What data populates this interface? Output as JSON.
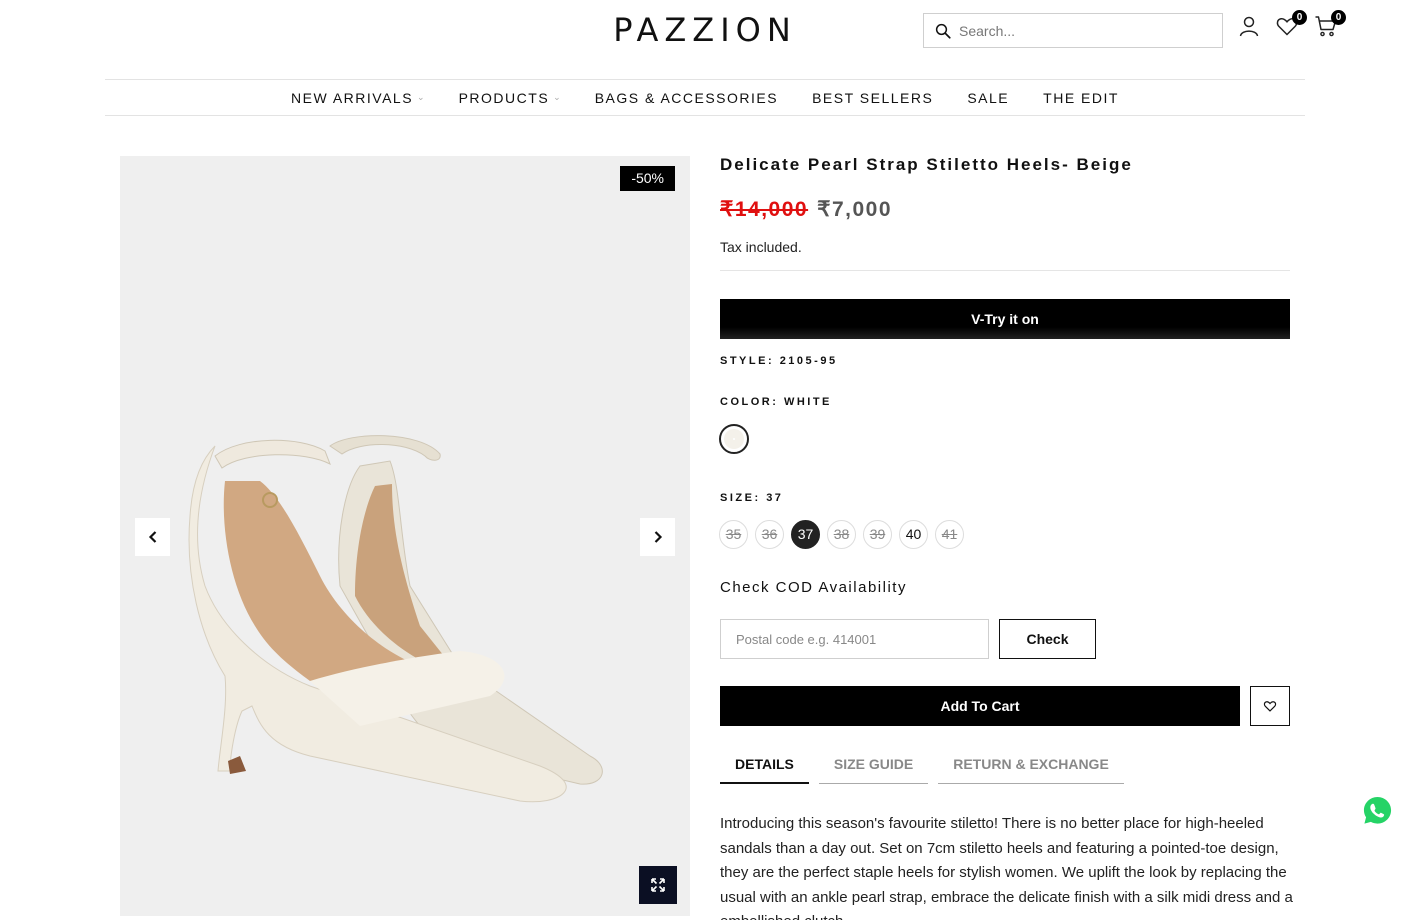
{
  "header": {
    "logo": "PAZZION",
    "search_placeholder": "Search...",
    "wishlist_count": "0",
    "cart_count": "0"
  },
  "nav": {
    "items": [
      {
        "label": "NEW ARRIVALS",
        "dropdown": true
      },
      {
        "label": "PRODUCTS",
        "dropdown": true
      },
      {
        "label": "BAGS & ACCESSORIES",
        "dropdown": false
      },
      {
        "label": "BEST SELLERS",
        "dropdown": false
      },
      {
        "label": "SALE",
        "dropdown": false
      },
      {
        "label": "THE EDIT",
        "dropdown": false
      }
    ]
  },
  "gallery": {
    "discount_badge": "-50%"
  },
  "product": {
    "title": "Delicate Pearl Strap Stiletto Heels- Beige",
    "old_price": "₹14,000",
    "new_price": "₹7,000",
    "tax_note": "Tax included.",
    "vtry_label": "V-Try it on",
    "style_label": "STYLE:",
    "style_value": "2105-95",
    "color_label": "COLOR:",
    "color_value": "WHITE",
    "size_label": "SIZE:",
    "size_value": "37",
    "sizes": [
      "35",
      "36",
      "37",
      "38",
      "39",
      "40",
      "41"
    ],
    "cod_title": "Check COD Availability",
    "postal_placeholder": "Postal code e.g. 414001",
    "check_label": "Check",
    "add_to_cart_label": "Add To Cart"
  },
  "tabs": [
    "DETAILS",
    "SIZE GUIDE",
    "RETURN & EXCHANGE"
  ],
  "description": "Introducing this season's favourite stiletto! There is no better place for high-heeled sandals than a day out. Set on 7cm stiletto heels and featuring a pointed-toe design, they are the perfect staple heels for stylish women. We uplift the look by replacing the usual with an ankle pearl strap, embrace the delicate finish with a silk midi dress and a embellished clutch.",
  "colors": {
    "accent": "#000000",
    "sale_red": "#e01010",
    "whatsapp": "#25d366"
  }
}
